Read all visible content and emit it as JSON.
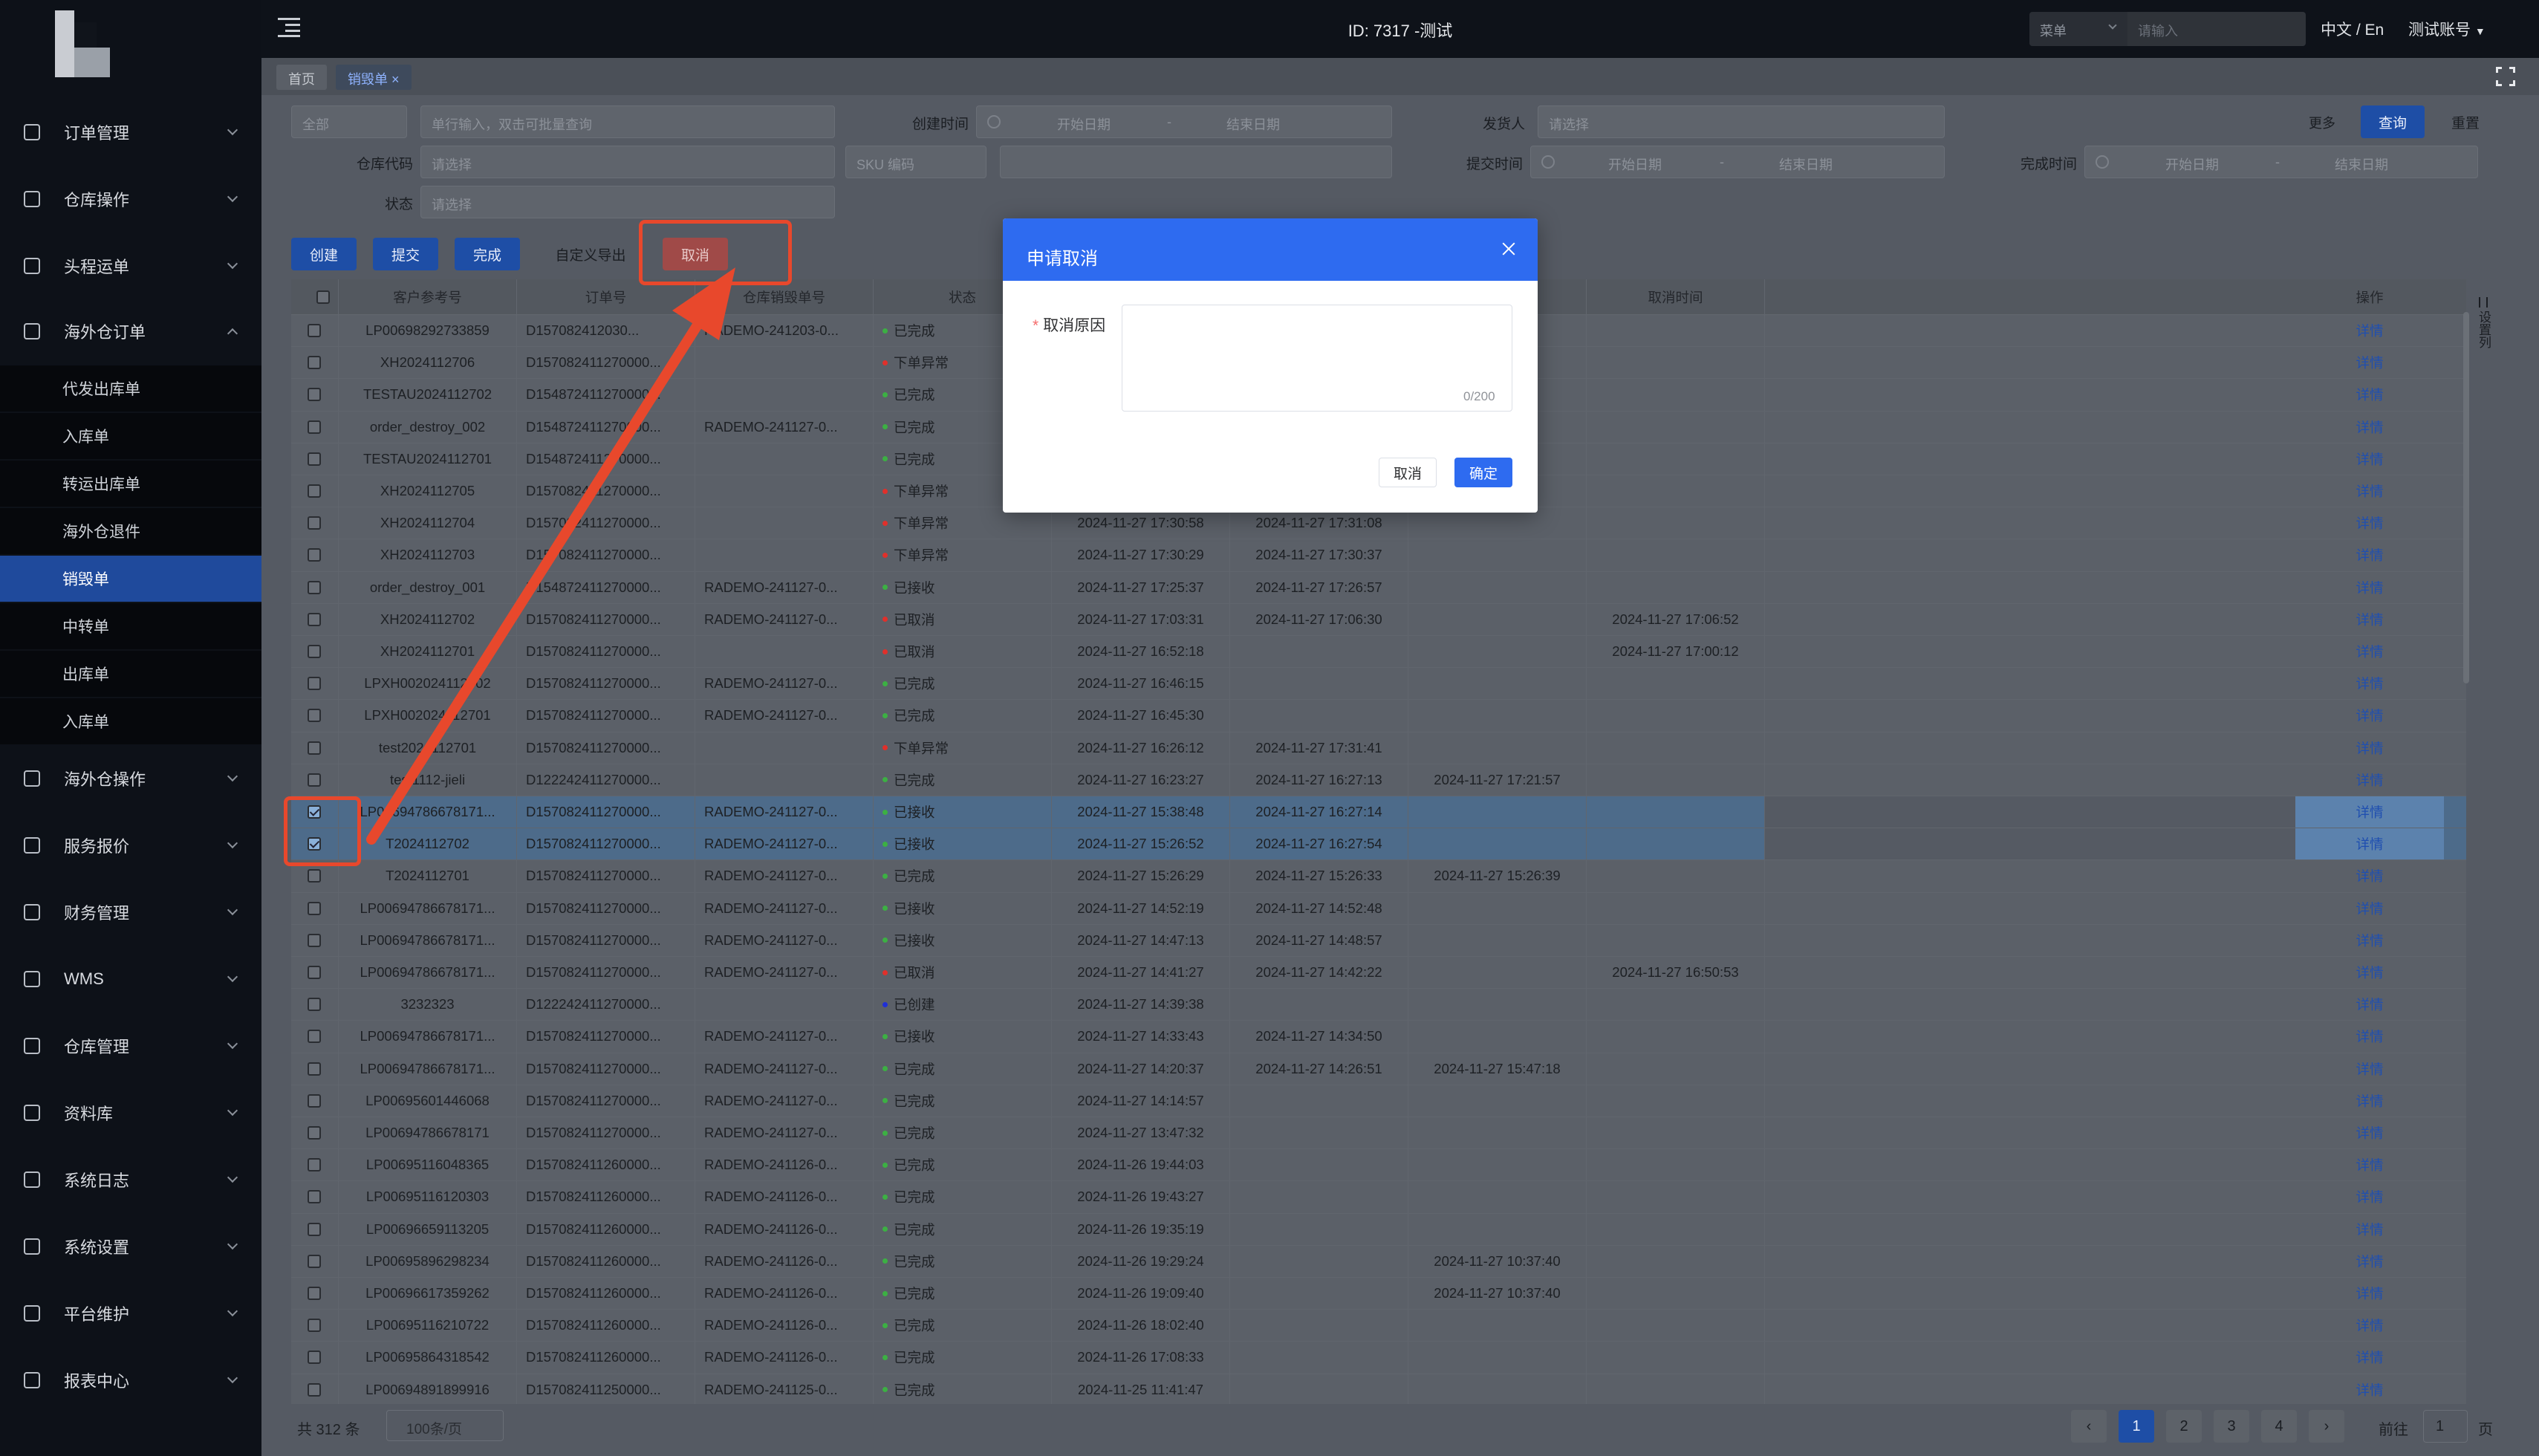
{
  "topbar": {
    "title": "ID: 7317 -测试",
    "search_select": "菜单",
    "search_placeholder": "请输入",
    "lang": "中文 / En",
    "account": "测试账号"
  },
  "sidebar": {
    "menus": [
      {
        "label": "订单管理",
        "open": false
      },
      {
        "label": "仓库操作",
        "open": false
      },
      {
        "label": "头程运单",
        "open": false
      },
      {
        "label": "海外仓订单",
        "open": true
      },
      {
        "label": "海外仓操作",
        "open": false
      },
      {
        "label": "服务报价",
        "open": false
      },
      {
        "label": "财务管理",
        "open": false
      },
      {
        "label": "WMS",
        "open": false
      },
      {
        "label": "仓库管理",
        "open": false
      },
      {
        "label": "资料库",
        "open": false
      },
      {
        "label": "系统日志",
        "open": false
      },
      {
        "label": "系统设置",
        "open": false
      },
      {
        "label": "平台维护",
        "open": false
      },
      {
        "label": "报表中心",
        "open": false
      }
    ],
    "submenu": [
      {
        "label": "代发出库单",
        "active": false
      },
      {
        "label": "入库单",
        "active": false
      },
      {
        "label": "转运出库单",
        "active": false
      },
      {
        "label": "海外仓退件",
        "active": false
      },
      {
        "label": "销毁单",
        "active": true
      },
      {
        "label": "中转单",
        "active": false
      },
      {
        "label": "出库单",
        "active": false
      },
      {
        "label": "入库单",
        "active": false
      }
    ]
  },
  "tabs": [
    {
      "label": "首页",
      "active": false
    },
    {
      "label": "销毁单 ×",
      "active": true
    }
  ],
  "filters": {
    "all_select": "全部",
    "keyword_placeholder": "单行输入，双击可批量查询",
    "created_label": "创建时间",
    "start_placeholder": "开始日期",
    "dash": "-",
    "end_placeholder": "结束日期",
    "shipper_label": "发货人",
    "select_placeholder": "请选择",
    "more": "更多",
    "query": "查询",
    "reset": "重置",
    "warehouse_label": "仓库代码",
    "sku_select": "SKU 编码",
    "submit_label": "提交时间",
    "complete_label": "完成时间",
    "status_label": "状态"
  },
  "toolbar": {
    "create": "创建",
    "submit": "提交",
    "complete": "完成",
    "export": "自定义导出",
    "cancel": "取消"
  },
  "table": {
    "headers": [
      "客户参考号",
      "订单号",
      "仓库销毁单号",
      "状态",
      "",
      "",
      "取消时间",
      "操作"
    ],
    "detail": "详情",
    "rows": [
      {
        "ref": "LP00698292733859",
        "order": "D157082412030...",
        "wh": "RADEMO-241203-0...",
        "status": "已完成",
        "sc": "green",
        "t1": "",
        "t2": "",
        "t3": "",
        "t4": "",
        "sel": false
      },
      {
        "ref": "XH2024112706",
        "order": "D157082411270000...",
        "wh": "",
        "status": "下单异常",
        "sc": "red",
        "t1": "",
        "t2": "",
        "t3": "",
        "t4": "",
        "sel": false
      },
      {
        "ref": "TESTAU2024112702",
        "order": "D154872411270000...",
        "wh": "",
        "status": "已完成",
        "sc": "green",
        "t1": "",
        "t2": "",
        "t3": "3:19",
        "t4": "",
        "sel": false
      },
      {
        "ref": "order_destroy_002",
        "order": "D154872411270000...",
        "wh": "RADEMO-241127-0...",
        "status": "已完成",
        "sc": "green",
        "t1": "",
        "t2": "",
        "t3": "2:01",
        "t4": "",
        "sel": false
      },
      {
        "ref": "TESTAU2024112701",
        "order": "D154872411270000...",
        "wh": "",
        "status": "已完成",
        "sc": "green",
        "t1": "",
        "t2": "",
        "t3": ":37",
        "t4": "",
        "sel": false
      },
      {
        "ref": "XH2024112705",
        "order": "D157082411270000...",
        "wh": "",
        "status": "下单异常",
        "sc": "red",
        "t1": "",
        "t2": "",
        "t3": "",
        "t4": "",
        "sel": false
      },
      {
        "ref": "XH2024112704",
        "order": "D157082411270000...",
        "wh": "",
        "status": "下单异常",
        "sc": "red",
        "t1": "2024-11-27 17:30:58",
        "t2": "2024-11-27 17:31:08",
        "t3": "",
        "t4": "",
        "sel": false
      },
      {
        "ref": "XH2024112703",
        "order": "D157082411270000...",
        "wh": "",
        "status": "下单异常",
        "sc": "red",
        "t1": "2024-11-27 17:30:29",
        "t2": "2024-11-27 17:30:37",
        "t3": "",
        "t4": "",
        "sel": false
      },
      {
        "ref": "order_destroy_001",
        "order": "D154872411270000...",
        "wh": "RADEMO-241127-0...",
        "status": "已接收",
        "sc": "green",
        "t1": "2024-11-27 17:25:37",
        "t2": "2024-11-27 17:26:57",
        "t3": "",
        "t4": "",
        "sel": false
      },
      {
        "ref": "XH2024112702",
        "order": "D157082411270000...",
        "wh": "RADEMO-241127-0...",
        "status": "已取消",
        "sc": "red",
        "t1": "2024-11-27 17:03:31",
        "t2": "2024-11-27 17:06:30",
        "t3": "",
        "t4": "2024-11-27 17:06:52",
        "sel": false
      },
      {
        "ref": "XH2024112701",
        "order": "D157082411270000...",
        "wh": "",
        "status": "已取消",
        "sc": "red",
        "t1": "2024-11-27 16:52:18",
        "t2": "",
        "t3": "",
        "t4": "2024-11-27 17:00:12",
        "sel": false
      },
      {
        "ref": "LPXH002024112702",
        "order": "D157082411270000...",
        "wh": "RADEMO-241127-0...",
        "status": "已完成",
        "sc": "green",
        "t1": "2024-11-27 16:46:15",
        "t2": "",
        "t3": "",
        "t4": "",
        "sel": false
      },
      {
        "ref": "LPXH002024112701",
        "order": "D157082411270000...",
        "wh": "RADEMO-241127-0...",
        "status": "已完成",
        "sc": "green",
        "t1": "2024-11-27 16:45:30",
        "t2": "",
        "t3": "",
        "t4": "",
        "sel": false
      },
      {
        "ref": "test2024112701",
        "order": "D157082411270000...",
        "wh": "",
        "status": "下单异常",
        "sc": "red",
        "t1": "2024-11-27 16:26:12",
        "t2": "2024-11-27 17:31:41",
        "t3": "",
        "t4": "",
        "sel": false
      },
      {
        "ref": "test1112-jieli",
        "order": "D122242411270000...",
        "wh": "",
        "status": "已完成",
        "sc": "green",
        "t1": "2024-11-27 16:23:27",
        "t2": "2024-11-27 16:27:13",
        "t3": "2024-11-27 17:21:57",
        "t4": "",
        "sel": false
      },
      {
        "ref": "LP00694786678171...",
        "order": "D157082411270000...",
        "wh": "RADEMO-241127-0...",
        "status": "已接收",
        "sc": "green",
        "t1": "2024-11-27 15:38:48",
        "t2": "2024-11-27 16:27:14",
        "t3": "",
        "t4": "",
        "sel": true
      },
      {
        "ref": "T2024112702",
        "order": "D157082411270000...",
        "wh": "RADEMO-241127-0...",
        "status": "已接收",
        "sc": "green",
        "t1": "2024-11-27 15:26:52",
        "t2": "2024-11-27 16:27:54",
        "t3": "",
        "t4": "",
        "sel": true
      },
      {
        "ref": "T2024112701",
        "order": "D157082411270000...",
        "wh": "RADEMO-241127-0...",
        "status": "已完成",
        "sc": "green",
        "t1": "2024-11-27 15:26:29",
        "t2": "2024-11-27 15:26:33",
        "t3": "2024-11-27 15:26:39",
        "t4": "",
        "sel": false
      },
      {
        "ref": "LP00694786678171...",
        "order": "D157082411270000...",
        "wh": "RADEMO-241127-0...",
        "status": "已接收",
        "sc": "green",
        "t1": "2024-11-27 14:52:19",
        "t2": "2024-11-27 14:52:48",
        "t3": "",
        "t4": "",
        "sel": false
      },
      {
        "ref": "LP00694786678171...",
        "order": "D157082411270000...",
        "wh": "RADEMO-241127-0...",
        "status": "已接收",
        "sc": "green",
        "t1": "2024-11-27 14:47:13",
        "t2": "2024-11-27 14:48:57",
        "t3": "",
        "t4": "",
        "sel": false
      },
      {
        "ref": "LP00694786678171...",
        "order": "D157082411270000...",
        "wh": "RADEMO-241127-0...",
        "status": "已取消",
        "sc": "red",
        "t1": "2024-11-27 14:41:27",
        "t2": "2024-11-27 14:42:22",
        "t3": "",
        "t4": "2024-11-27 16:50:53",
        "sel": false
      },
      {
        "ref": "3232323",
        "order": "D122242411270000...",
        "wh": "",
        "status": "已创建",
        "sc": "blue",
        "t1": "2024-11-27 14:39:38",
        "t2": "",
        "t3": "",
        "t4": "",
        "sel": false
      },
      {
        "ref": "LP00694786678171...",
        "order": "D157082411270000...",
        "wh": "RADEMO-241127-0...",
        "status": "已接收",
        "sc": "green",
        "t1": "2024-11-27 14:33:43",
        "t2": "2024-11-27 14:34:50",
        "t3": "",
        "t4": "",
        "sel": false
      },
      {
        "ref": "LP00694786678171...",
        "order": "D157082411270000...",
        "wh": "RADEMO-241127-0...",
        "status": "已完成",
        "sc": "green",
        "t1": "2024-11-27 14:20:37",
        "t2": "2024-11-27 14:26:51",
        "t3": "2024-11-27 15:47:18",
        "t4": "",
        "sel": false
      },
      {
        "ref": "LP00695601446068",
        "order": "D157082411270000...",
        "wh": "RADEMO-241127-0...",
        "status": "已完成",
        "sc": "green",
        "t1": "2024-11-27 14:14:57",
        "t2": "",
        "t3": "",
        "t4": "",
        "sel": false
      },
      {
        "ref": "LP00694786678171",
        "order": "D157082411270000...",
        "wh": "RADEMO-241127-0...",
        "status": "已完成",
        "sc": "green",
        "t1": "2024-11-27 13:47:32",
        "t2": "",
        "t3": "",
        "t4": "",
        "sel": false
      },
      {
        "ref": "LP00695116048365",
        "order": "D157082411260000...",
        "wh": "RADEMO-241126-0...",
        "status": "已完成",
        "sc": "green",
        "t1": "2024-11-26 19:44:03",
        "t2": "",
        "t3": "",
        "t4": "",
        "sel": false
      },
      {
        "ref": "LP00695116120303",
        "order": "D157082411260000...",
        "wh": "RADEMO-241126-0...",
        "status": "已完成",
        "sc": "green",
        "t1": "2024-11-26 19:43:27",
        "t2": "",
        "t3": "",
        "t4": "",
        "sel": false
      },
      {
        "ref": "LP00696659113205",
        "order": "D157082411260000...",
        "wh": "RADEMO-241126-0...",
        "status": "已完成",
        "sc": "green",
        "t1": "2024-11-26 19:35:19",
        "t2": "",
        "t3": "",
        "t4": "",
        "sel": false
      },
      {
        "ref": "LP00695896298234",
        "order": "D157082411260000...",
        "wh": "RADEMO-241126-0...",
        "status": "已完成",
        "sc": "green",
        "t1": "2024-11-26 19:29:24",
        "t2": "",
        "t3": "2024-11-27 10:37:40",
        "t4": "",
        "sel": false
      },
      {
        "ref": "LP00696617359262",
        "order": "D157082411260000...",
        "wh": "RADEMO-241126-0...",
        "status": "已完成",
        "sc": "green",
        "t1": "2024-11-26 19:09:40",
        "t2": "",
        "t3": "2024-11-27 10:37:40",
        "t4": "",
        "sel": false
      },
      {
        "ref": "LP00695116210722",
        "order": "D157082411260000...",
        "wh": "RADEMO-241126-0...",
        "status": "已完成",
        "sc": "green",
        "t1": "2024-11-26 18:02:40",
        "t2": "",
        "t3": "",
        "t4": "",
        "sel": false
      },
      {
        "ref": "LP00695864318542",
        "order": "D157082411260000...",
        "wh": "RADEMO-241126-0...",
        "status": "已完成",
        "sc": "green",
        "t1": "2024-11-26 17:08:33",
        "t2": "",
        "t3": "",
        "t4": "",
        "sel": false
      },
      {
        "ref": "LP00694891899916",
        "order": "D157082411250000...",
        "wh": "RADEMO-241125-0...",
        "status": "已完成",
        "sc": "green",
        "t1": "2024-11-25 11:41:47",
        "t2": "",
        "t3": "",
        "t4": "",
        "sel": false
      }
    ]
  },
  "settings_col": "设置列",
  "footer": {
    "total": "共 312 条",
    "pagesize": "100条/页",
    "pages": [
      "1",
      "2",
      "3",
      "4"
    ],
    "goto": "前往",
    "goto_value": "1",
    "goto_suffix": "页"
  },
  "modal": {
    "title": "申请取消",
    "reason_label": "取消原因",
    "required_mark": "*",
    "count": "0/200",
    "cancel": "取消",
    "ok": "确定"
  },
  "colors": {
    "primary": "#2e6bf0",
    "annotation": "#e8482c",
    "status_green": "#3cb043",
    "status_red": "#e0302b",
    "status_blue": "#1f2fd6"
  }
}
